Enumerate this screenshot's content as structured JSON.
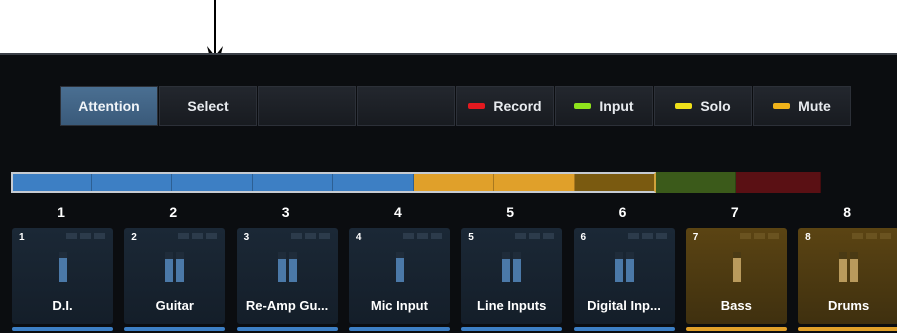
{
  "toolbar": {
    "attention_label": "Attention",
    "select_label": "Select",
    "record_label": "Record",
    "input_label": "Input",
    "solo_label": "Solo",
    "mute_label": "Mute"
  },
  "colors": {
    "record": "#e3191f",
    "input": "#8fe31c",
    "solo": "#efe01a",
    "mute": "#efb21a",
    "blue": "#3d7fc4",
    "orange": "#e0a02a",
    "olive": "#7a5a10",
    "green": "#3b5a1a",
    "red": "#5a1014"
  },
  "overview": {
    "segments": [
      "blue",
      "blue",
      "blue",
      "blue",
      "blue",
      "orange",
      "orange",
      "olive",
      "green",
      "red"
    ]
  },
  "tracks": [
    {
      "number": "1",
      "name": "D.I.",
      "color": "blue",
      "meter": "mono",
      "level": 0.8
    },
    {
      "number": "2",
      "name": "Guitar",
      "color": "blue",
      "meter": "stereo",
      "level": 0.75
    },
    {
      "number": "3",
      "name": "Re-Amp Gu...",
      "color": "blue",
      "meter": "stereo",
      "level": 0.75
    },
    {
      "number": "4",
      "name": "Mic Input",
      "color": "blue",
      "meter": "mono",
      "level": 0.8
    },
    {
      "number": "5",
      "name": "Line Inputs",
      "color": "blue",
      "meter": "stereo",
      "level": 0.75
    },
    {
      "number": "6",
      "name": "Digital Inp...",
      "color": "blue",
      "meter": "stereo",
      "level": 0.75
    },
    {
      "number": "7",
      "name": "Bass",
      "color": "orange",
      "meter": "mono",
      "level": 0.8
    },
    {
      "number": "8",
      "name": "Drums",
      "color": "orange",
      "meter": "stereo",
      "level": 0.75
    }
  ]
}
